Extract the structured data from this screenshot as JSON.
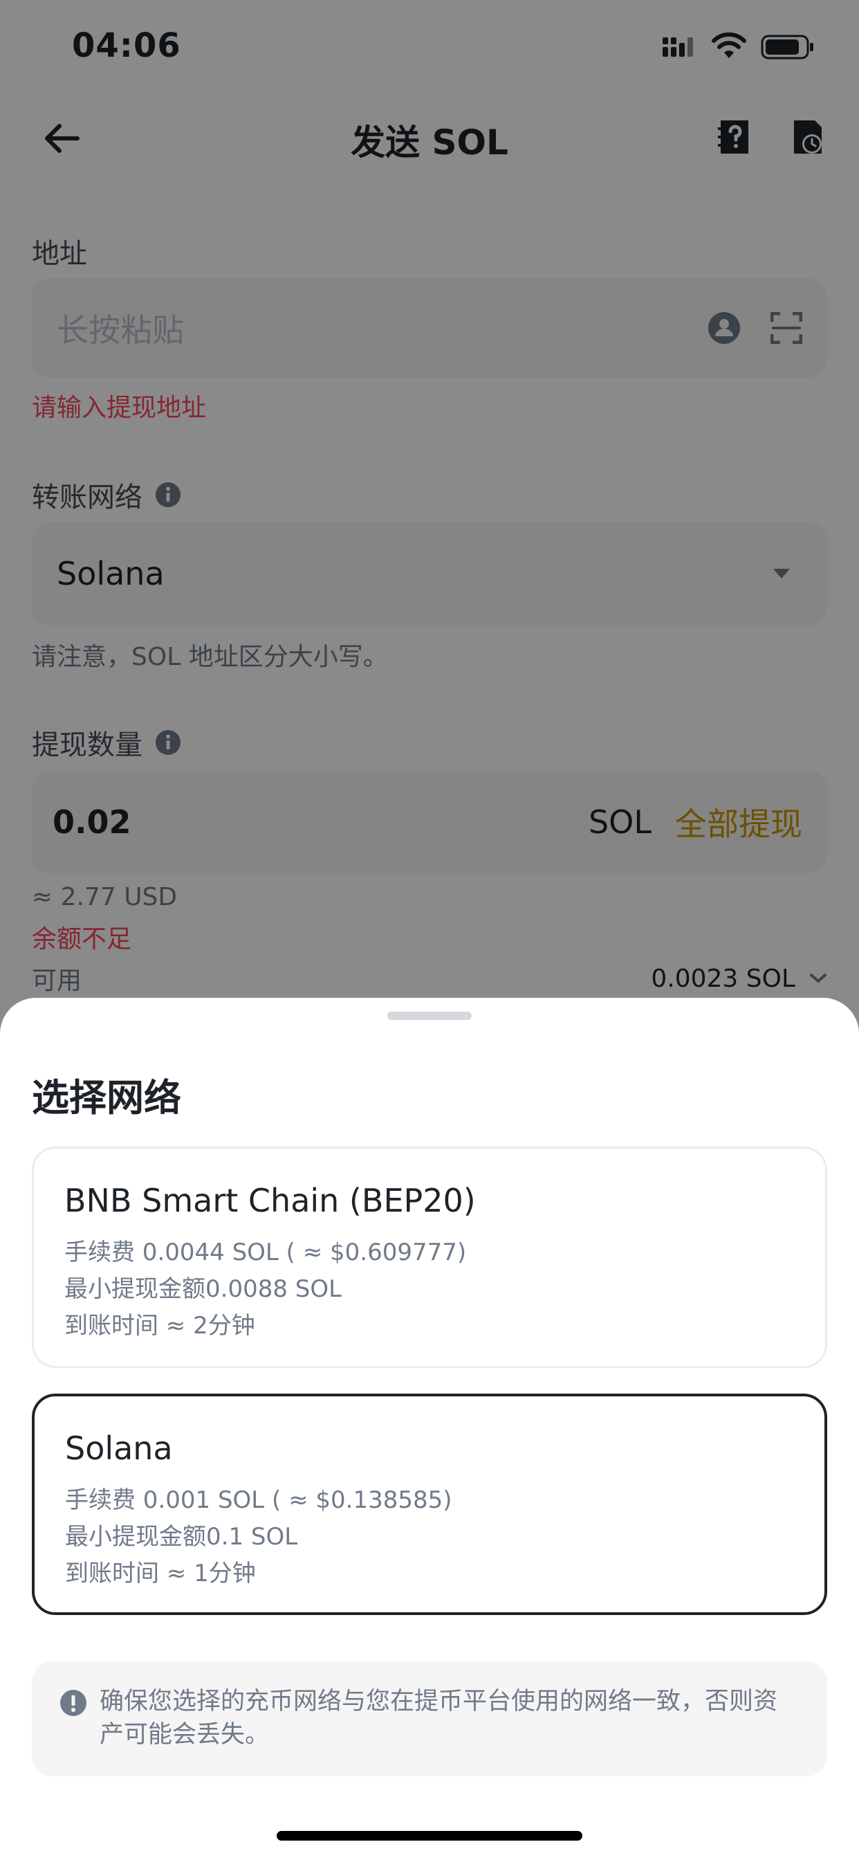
{
  "status_bar": {
    "time": "04:06"
  },
  "header": {
    "title": "发送 SOL"
  },
  "address": {
    "label": "地址",
    "placeholder": "长按粘贴",
    "error": "请输入提现地址"
  },
  "network": {
    "label": "转账网络",
    "selected": "Solana",
    "hint": "请注意，SOL 地址区分大小写。"
  },
  "amount": {
    "label": "提现数量",
    "value": "0.02",
    "unit": "SOL",
    "withdraw_all": "全部提现",
    "usd_equiv": "≈ 2.77 USD",
    "error": "余额不足",
    "available_label": "可用",
    "available_value": "0.0023 SOL"
  },
  "sheet": {
    "title": "选择网络",
    "networks": [
      {
        "name": "BNB Smart Chain (BEP20)",
        "fee": "手续费 0.0044 SOL ( ≈ $0.609777)",
        "min": "最小提现金额0.0088 SOL",
        "time": "到账时间 ≈ 2分钟",
        "selected": false
      },
      {
        "name": "Solana",
        "fee": "手续费 0.001 SOL ( ≈ $0.138585)",
        "min": "最小提现金额0.1 SOL",
        "time": "到账时间 ≈ 1分钟",
        "selected": true
      }
    ],
    "notice": "确保您选择的充币网络与您在提币平台使用的网络一致，否则资产可能会丢失。"
  },
  "colors": {
    "accent": "#c99400",
    "error": "#f6465d",
    "text_primary": "#1e2329",
    "text_secondary": "#707a8a",
    "field_bg": "#f5f5f5"
  }
}
